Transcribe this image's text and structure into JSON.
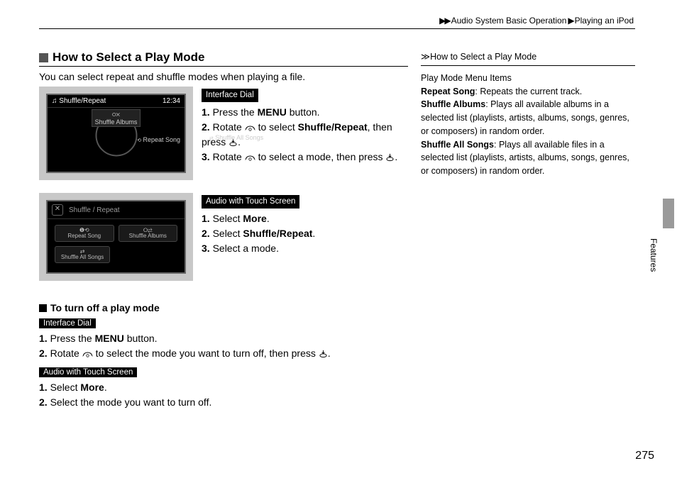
{
  "breadcrumb": {
    "a": "Audio System Basic Operation",
    "b": "Playing an iPod"
  },
  "heading": "How to Select a Play Mode",
  "intro": "You can select repeat and shuffle modes when playing a file.",
  "tags": {
    "dial": "Interface Dial",
    "touch": "Audio with Touch Screen"
  },
  "screen1": {
    "title": "Shuffle/Repeat",
    "clock": "12:34",
    "top": "Shuffle\nAlbums",
    "left": "Shuffle All\nSongs",
    "right": "Repeat Song"
  },
  "dial_steps": {
    "s1a": "1.",
    "s1b": " Press the ",
    "s1c": "MENU",
    "s1d": " button.",
    "s2a": "2.",
    "s2b": " Rotate ",
    "s2c": " to select ",
    "s2d": "Shuffle/Repeat",
    "s2e": ", then press ",
    "s3a": "3.",
    "s3b": " Rotate ",
    "s3c": " to select a mode, then press "
  },
  "screen2": {
    "title": "Shuffle / Repeat",
    "c1": "Repeat Song",
    "c2": "Shuffle Albums",
    "c3": "Shuffle All Songs"
  },
  "touch_steps": {
    "s1a": "1.",
    "s1b": " Select ",
    "s1c": "More",
    "s1d": ".",
    "s2a": "2.",
    "s2b": " Select ",
    "s2c": "Shuffle/Repeat",
    "s2d": ".",
    "s3a": "3.",
    "s3b": " Select a mode."
  },
  "off": {
    "heading": "To turn off a play mode",
    "d1a": "1.",
    "d1b": " Press the ",
    "d1c": "MENU",
    "d1d": " button.",
    "d2a": "2.",
    "d2b": " Rotate ",
    "d2c": " to select the mode you want to turn off, then press ",
    "t1a": "1.",
    "t1b": " Select ",
    "t1c": "More",
    "t1d": ".",
    "t2a": "2.",
    "t2b": " Select the mode you want to turn off."
  },
  "side": {
    "title": "How to Select a Play Mode",
    "p0": "Play Mode Menu Items",
    "p1a": "Repeat Song",
    "p1b": ": Repeats the current track.",
    "p2a": "Shuffle Albums",
    "p2b": ": Plays all available albums in a selected list (playlists, artists, albums, songs, genres, or composers) in random order.",
    "p3a": "Shuffle All Songs",
    "p3b": ": Plays all available files in a selected list (playlists, artists, albums, songs, genres, or composers) in random order."
  },
  "page_number": "275",
  "side_label": "Features"
}
